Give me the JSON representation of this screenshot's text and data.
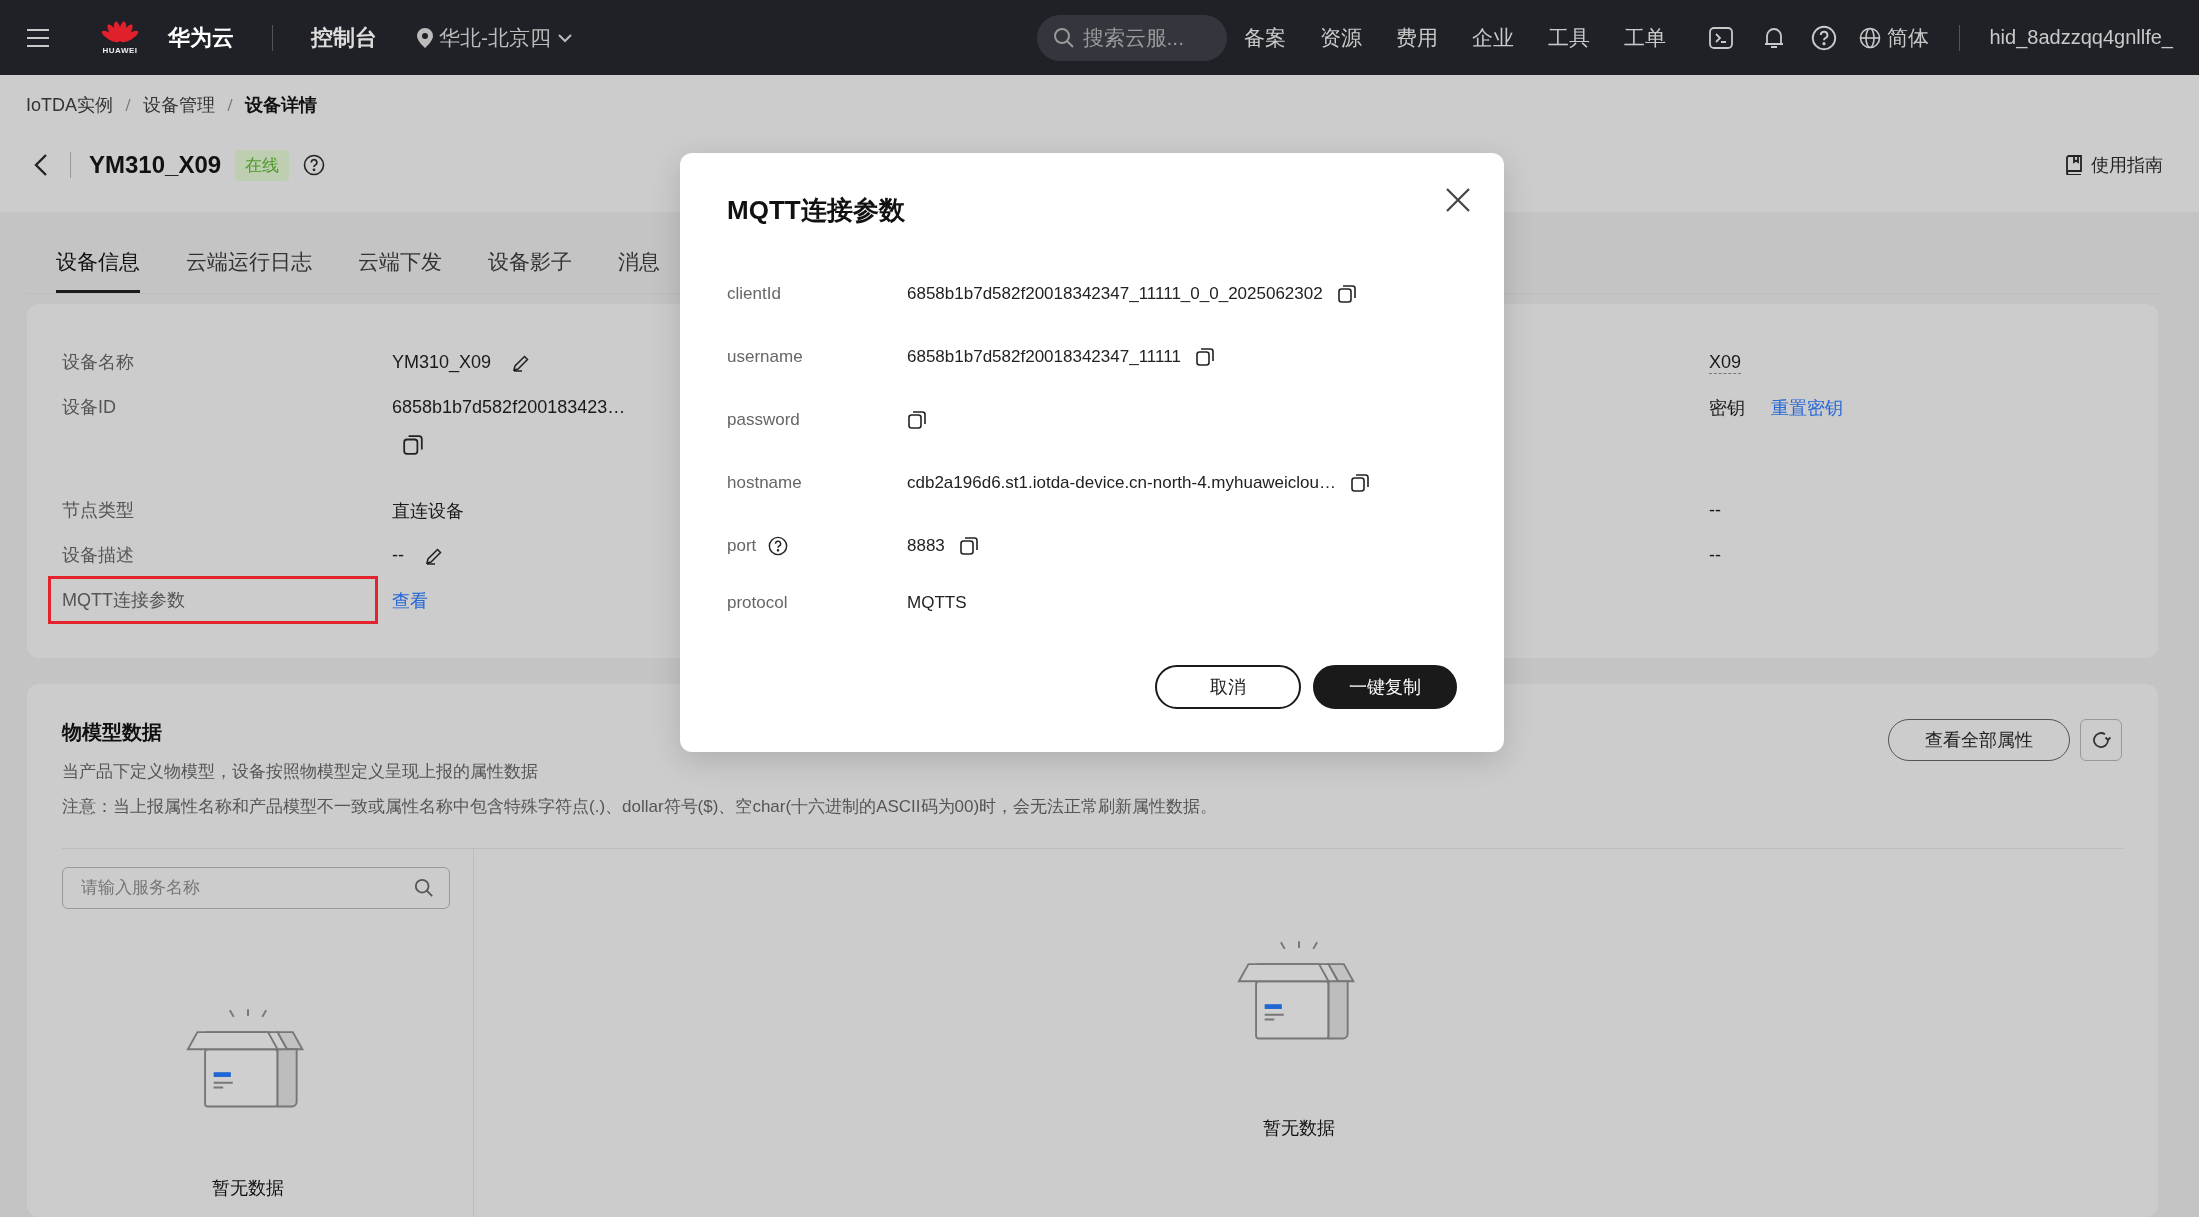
{
  "top_bar": {
    "brand_mark": "HUAWEI",
    "brand": "华为云",
    "console": "控制台",
    "region": "华北-北京四",
    "search": {
      "placeholder": "搜索云服..."
    },
    "nav": [
      "备案",
      "资源",
      "费用",
      "企业",
      "工具",
      "工单"
    ],
    "language": "简体",
    "user": "hid_8adzzqq4gnllfe_"
  },
  "breadcrumb": [
    {
      "label": "IoTDA实例",
      "current": false
    },
    {
      "label": "设备管理",
      "current": false
    },
    {
      "label": "设备详情",
      "current": true
    }
  ],
  "header": {
    "title": "YM310_X09",
    "status": {
      "label": "在线",
      "kind": "online"
    },
    "guide": "使用指南"
  },
  "tabs": [
    {
      "label": "设备信息",
      "selected": true
    },
    {
      "label": "云端运行日志",
      "selected": false
    },
    {
      "label": "云端下发",
      "selected": false
    },
    {
      "label": "设备影子",
      "selected": false
    },
    {
      "label": "消息",
      "selected": false
    }
  ],
  "device_info": {
    "rows": [
      {
        "label": "设备名称",
        "value": "YM310_X09",
        "kind": "editable",
        "highlighted": false
      },
      {
        "label": "设备ID",
        "value": "6858b1b7d582f200183423…",
        "kind": "copyable",
        "highlighted": false
      },
      {
        "label": "节点类型",
        "value": "直连设备",
        "kind": "text",
        "highlighted": false
      },
      {
        "label": "设备描述",
        "value": "--",
        "kind": "editable",
        "highlighted": false
      },
      {
        "label": "MQTT连接参数",
        "value": "查看",
        "kind": "link",
        "highlighted": true
      }
    ],
    "right_values": [
      {
        "value": "X09",
        "kind": "dotted"
      },
      {
        "value": "密钥",
        "link": "重置密钥",
        "kind": "secret"
      },
      {
        "value": "--",
        "kind": "text"
      },
      {
        "value": "--",
        "kind": "text"
      }
    ]
  },
  "thing_model": {
    "title": "物模型数据",
    "descriptions": [
      "当产品下定义物模型，设备按照物模型定义呈现上报的属性数据",
      "注意：当上报属性名称和产品模型不一致或属性名称中包含特殊字符点(.)、dollar符号($)、空char(十六进制的ASCII码为00)时，会无法正常刷新属性数据。"
    ],
    "view_all": "查看全部属性",
    "search": {
      "placeholder": "请输入服务名称"
    },
    "empty_left": "暂无数据",
    "empty_right": "暂无数据"
  },
  "dialog": {
    "title": "MQTT连接参数",
    "params": [
      {
        "label": "clientId",
        "value": "6858b1b7d582f20018342347_11111_0_0_2025062302",
        "copyable": true,
        "help": false
      },
      {
        "label": "username",
        "value": "6858b1b7d582f20018342347_11111",
        "copyable": true,
        "help": false
      },
      {
        "label": "password",
        "copyable": true,
        "help": false
      },
      {
        "label": "hostname",
        "value": "cdb2a196d6.st1.iotda-device.cn-north-4.myhuaweiclou…",
        "copyable": true,
        "help": false
      },
      {
        "label": "port",
        "value": "8883",
        "copyable": true,
        "help": true
      },
      {
        "label": "protocol",
        "value": "MQTTS",
        "copyable": false,
        "help": false
      }
    ],
    "buttons": [
      {
        "label": "取消",
        "kind": "secondary"
      },
      {
        "label": "一键复制",
        "kind": "primary"
      }
    ]
  }
}
